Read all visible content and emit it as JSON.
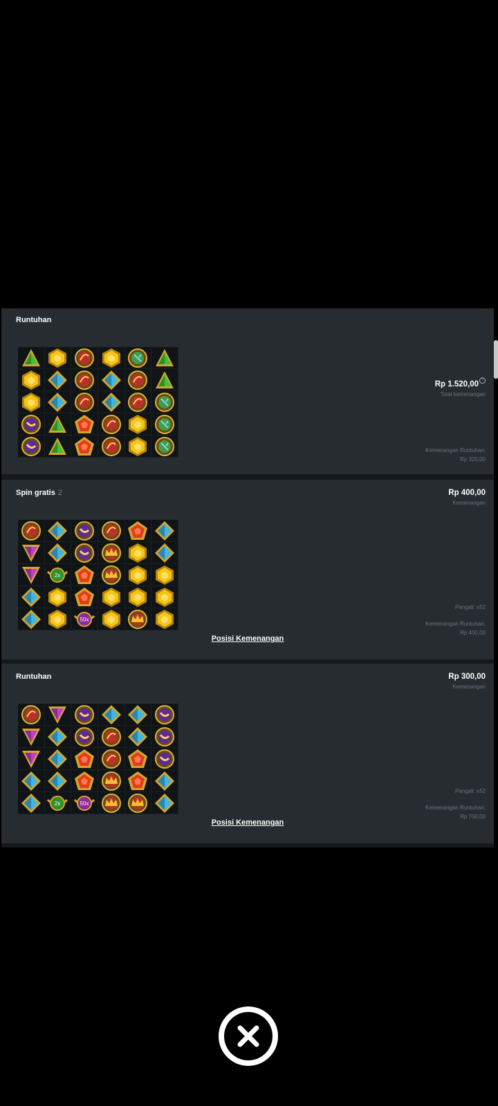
{
  "cards": [
    {
      "title": "Runtuhan",
      "title_sub": "",
      "total_amount": "Rp 1.520,00",
      "total_caption": "Total kemenangan",
      "info_icon": "?",
      "cascade_label": "Kemenangan Runtuhan:",
      "cascade_value": "Rp 320,00",
      "grid": [
        [
          "green-tri",
          "yellow-hex",
          "red-orb",
          "yellow-hex",
          "green-orb",
          "green-tri"
        ],
        [
          "yellow-hex",
          "blue-diamond",
          "red-orb",
          "blue-diamond",
          "red-orb",
          "green-tri"
        ],
        [
          "yellow-hex",
          "blue-diamond",
          "red-orb",
          "blue-diamond",
          "red-orb",
          "green-orb"
        ],
        [
          "purple-orb",
          "green-tri",
          "red-pent",
          "red-orb",
          "yellow-hex",
          "green-orb"
        ],
        [
          "purple-orb",
          "green-tri",
          "red-pent",
          "red-orb",
          "yellow-hex",
          "green-orb"
        ]
      ]
    },
    {
      "title": "Spin gratis",
      "title_sub": "2",
      "amount": "Rp 400,00",
      "amount_caption": "Kemenangan",
      "multiplier_label": "Pengali: x52",
      "cascade_label": "Kemenangan Runtuhan:",
      "cascade_value": "Rp 400,00",
      "link": "Posisi Kemenangan",
      "grid": [
        [
          "red-orb",
          "blue-diamond",
          "purple-orb",
          "red-orb",
          "red-pent",
          "blue-diamond"
        ],
        [
          "purple-tri",
          "blue-diamond",
          "purple-orb",
          "crown",
          "yellow-hex",
          "blue-diamond"
        ],
        [
          "purple-tri",
          "mult-green",
          "red-pent",
          "crown",
          "yellow-hex",
          "yellow-hex"
        ],
        [
          "blue-diamond",
          "yellow-hex",
          "red-pent",
          "yellow-hex",
          "yellow-hex",
          "yellow-hex"
        ],
        [
          "blue-diamond",
          "yellow-hex",
          "mult-purple",
          "yellow-hex",
          "crown",
          "yellow-hex"
        ]
      ],
      "multipliers": {
        "mult-green": "2x",
        "mult-purple": "50x"
      }
    },
    {
      "title": "Runtuhan",
      "title_sub": "",
      "amount": "Rp 300,00",
      "amount_caption": "Kemenangan",
      "multiplier_label": "Pengali: x52",
      "cascade_label": "Kemenangan Runtuhan:",
      "cascade_value": "Rp 700,00",
      "link": "Posisi Kemenangan",
      "grid": [
        [
          "red-orb",
          "purple-tri",
          "purple-orb",
          "blue-diamond",
          "blue-diamond",
          "purple-orb"
        ],
        [
          "purple-tri",
          "blue-diamond",
          "purple-orb",
          "red-orb",
          "blue-diamond",
          "purple-orb"
        ],
        [
          "purple-tri",
          "blue-diamond",
          "red-pent",
          "red-orb",
          "red-pent",
          "purple-orb"
        ],
        [
          "blue-diamond",
          "blue-diamond",
          "red-pent",
          "crown",
          "red-pent",
          "blue-diamond"
        ],
        [
          "blue-diamond",
          "mult-green",
          "mult-purple",
          "crown",
          "crown",
          "blue-diamond"
        ]
      ],
      "multipliers": {
        "mult-green": "2x",
        "mult-purple": "50x"
      }
    }
  ],
  "close_button": {
    "icon": "close-icon"
  },
  "colors": {
    "panel": "#262c30",
    "background": "#000000"
  }
}
